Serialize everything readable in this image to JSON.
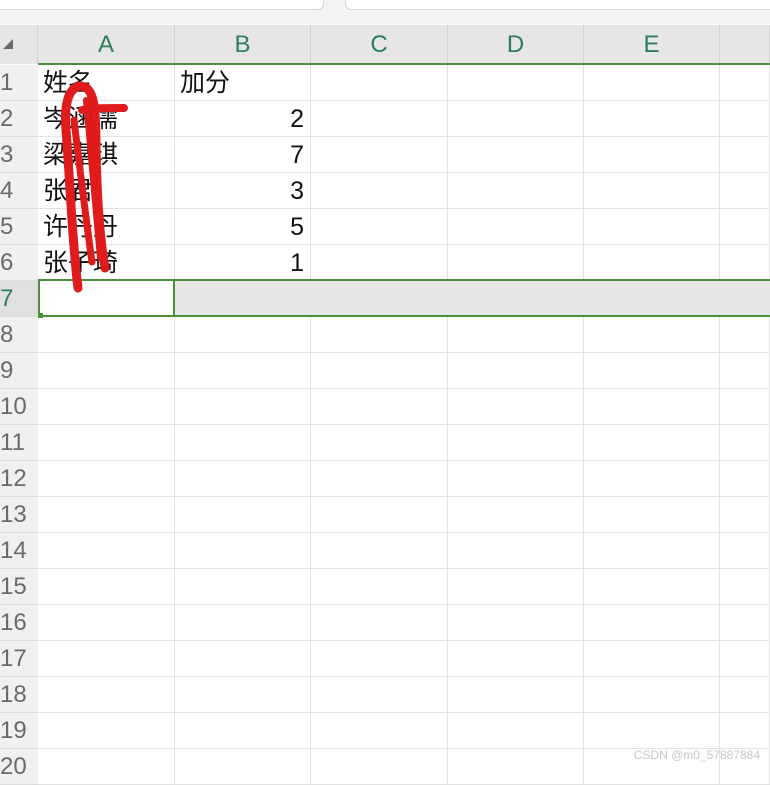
{
  "columns": [
    "A",
    "B",
    "C",
    "D",
    "E"
  ],
  "rows": [
    "1",
    "2",
    "3",
    "4",
    "5",
    "6",
    "7",
    "8",
    "9",
    "10",
    "11",
    "12",
    "13",
    "14",
    "15",
    "16",
    "17",
    "18",
    "19",
    "20"
  ],
  "cells": {
    "A1": "姓名",
    "B1": "加分",
    "A2": "岑涵儒",
    "B2": "2",
    "A3": "梁嘉琪",
    "B3": "7",
    "A4": "张君",
    "B4": "3",
    "A5": "许丹丹",
    "B5": "5",
    "A6": "张子琦",
    "B6": "1"
  },
  "selected_row": "7",
  "active_cell": "A7",
  "colors": {
    "accent_green": "#4c8f3a",
    "header_text_green": "#2e7d5b",
    "scribble_red": "#e01b1b"
  },
  "watermark": "CSDN @m0_57887884"
}
